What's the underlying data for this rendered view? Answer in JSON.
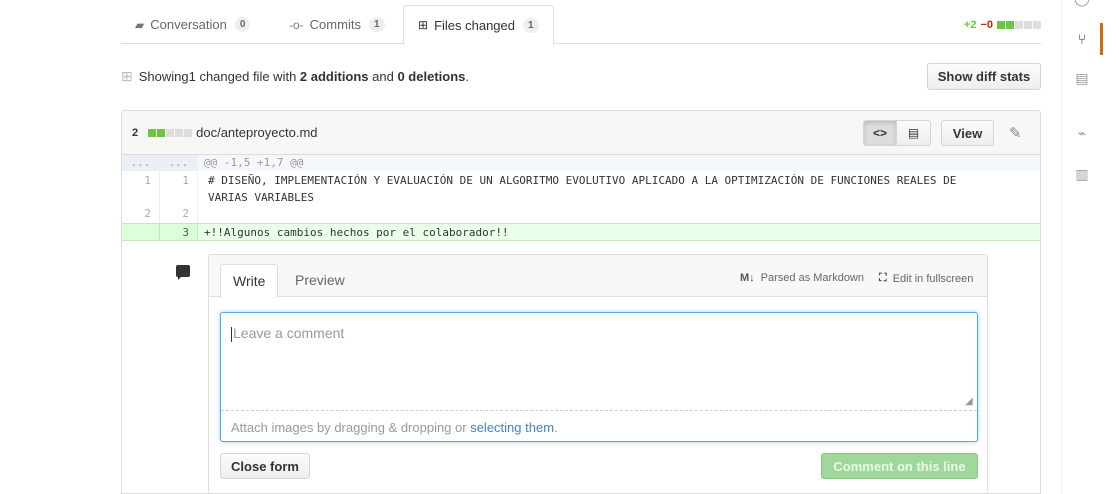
{
  "tabs": [
    {
      "label": "Conversation",
      "count": "0",
      "icon": "comment-discussion-icon"
    },
    {
      "label": "Commits",
      "count": "1",
      "icon": "commit-icon"
    },
    {
      "label": "Files changed",
      "count": "1",
      "icon": "file-diff-icon"
    }
  ],
  "diffstat": {
    "additions": "+2",
    "deletions": "−0"
  },
  "summary": {
    "prefix": "Showing ",
    "count": "1",
    "mid": " changed file with ",
    "additions": "2 additions",
    "and": " and ",
    "deletions": "0 deletions",
    "suffix": "."
  },
  "toolbar": {
    "diff_stats_label": "Show diff stats"
  },
  "file": {
    "changes": "2",
    "path": "doc/anteproyecto.md",
    "view_label": "View"
  },
  "diff": {
    "hunk_ln_old": "...",
    "hunk_ln_new": "...",
    "hunk_header": "@@ -1,5 +1,7 @@",
    "lines": [
      {
        "old": "1",
        "new": "1",
        "text": "# DISEÑO, IMPLEMENTACIÓN Y EVALUACIÓN DE UN ALGORITMO EVOLUTIVO APLICADO A LA OPTIMIZACIÓN DE FUNCIONES REALES DE\nVARIAS VARIABLES"
      },
      {
        "old": "2",
        "new": "2",
        "text": ""
      },
      {
        "old": "",
        "new": "3",
        "text": "+!!Algunos cambios hechos por el colaborador!!"
      }
    ]
  },
  "comment_form": {
    "tab_write": "Write",
    "tab_preview": "Preview",
    "markdown_label": "Parsed as Markdown",
    "fullscreen_label": "Edit in fullscreen",
    "placeholder": "Leave a comment",
    "attach_prefix": "Attach images by dragging & dropping or ",
    "attach_link": "selecting them",
    "attach_suffix": ".",
    "close_label": "Close form",
    "submit_label": "Comment on this line"
  },
  "colors": {
    "added": "#6cc644",
    "deleted": "#bd2c00",
    "accent": "#d26911"
  }
}
